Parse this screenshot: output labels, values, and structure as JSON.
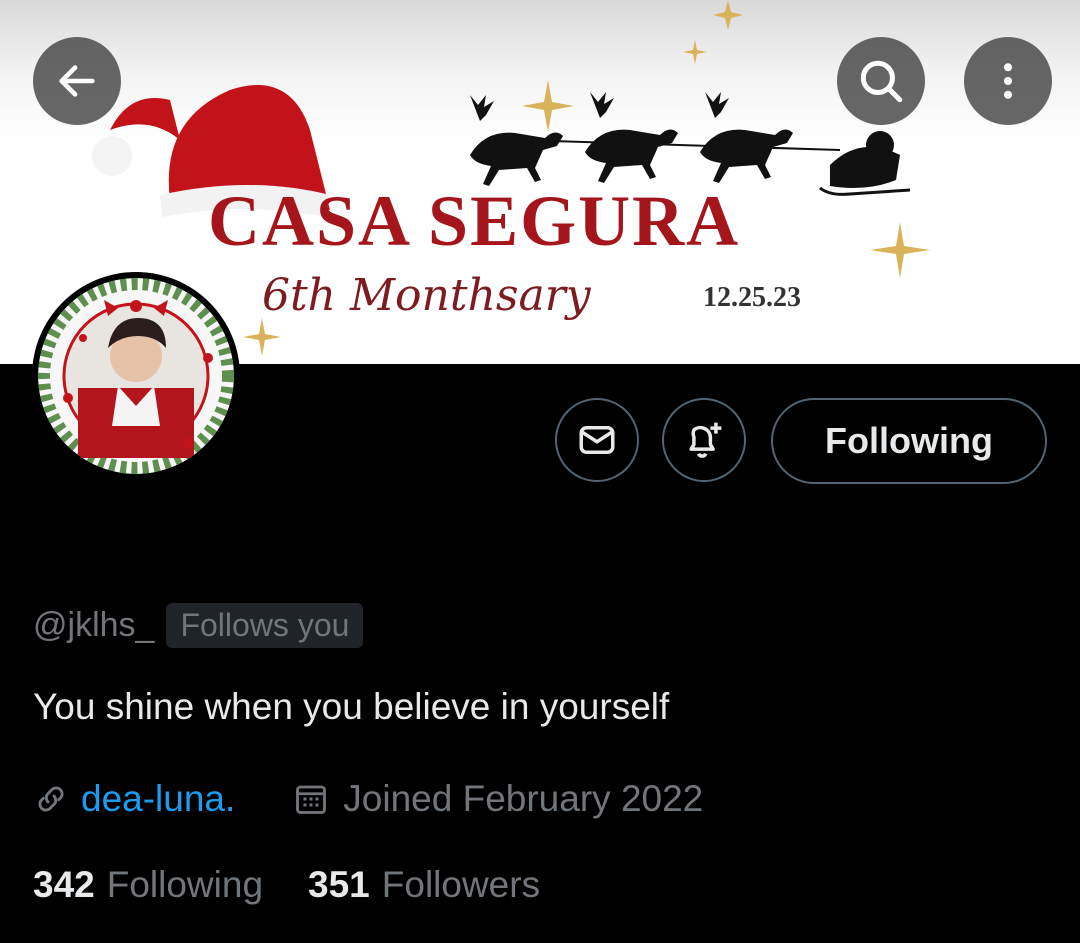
{
  "banner": {
    "title": "CASA SEGURA",
    "subtitle": "6th Monthsary",
    "date": "12.25.23"
  },
  "nav": {
    "back_icon": "arrow-left-icon",
    "search_icon": "search-icon",
    "more_icon": "more-vertical-icon"
  },
  "profile": {
    "handle": "@jklhs_",
    "follows_you": "Follows you",
    "bio": "You shine when you believe in yourself",
    "link": "dea-luna.",
    "joined": "Joined February 2022",
    "following_count": "342",
    "following_label": "Following",
    "followers_count": "351",
    "followers_label": "Followers"
  },
  "actions": {
    "following_button": "Following",
    "message_icon": "envelope-icon",
    "notify_icon": "bell-plus-icon"
  },
  "colors": {
    "background": "#000000",
    "text_primary": "#e7e9ea",
    "text_secondary": "#71767b",
    "link": "#1d9bf0",
    "border": "#536471"
  }
}
